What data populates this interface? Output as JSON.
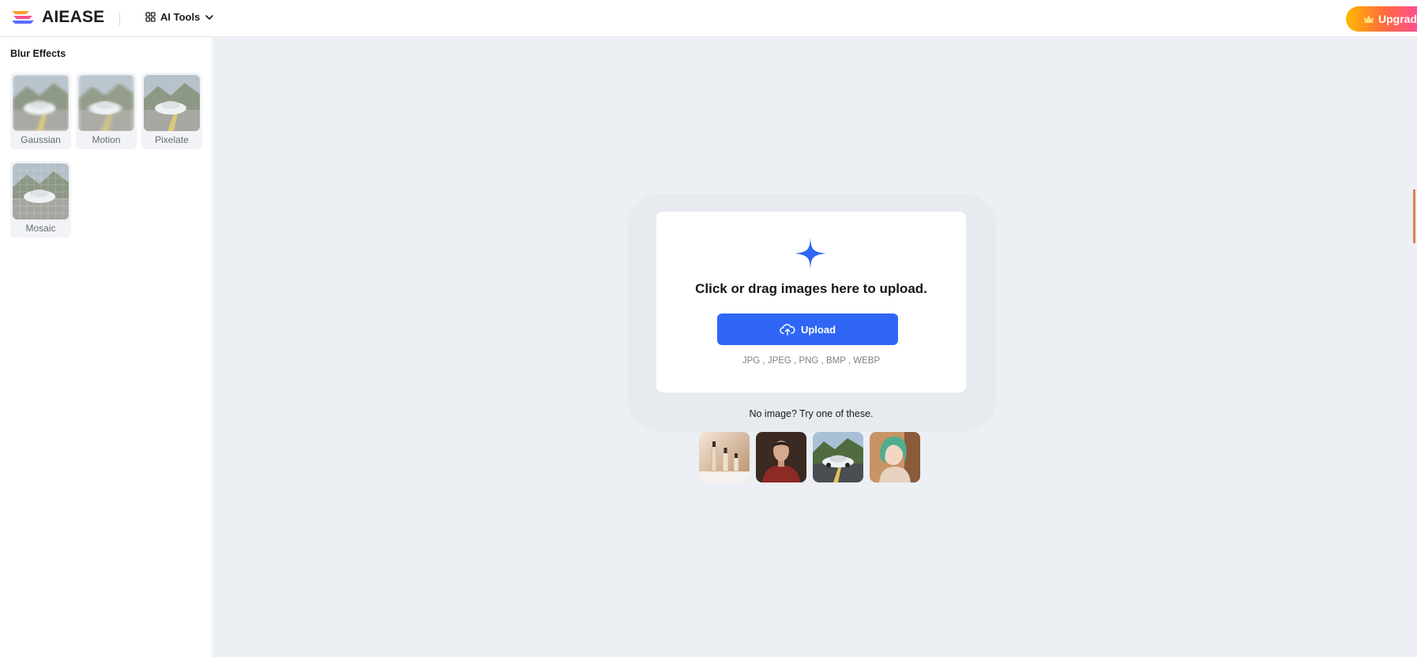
{
  "header": {
    "logo_text": "AIEASE",
    "ai_tools_label": "AI Tools",
    "upgrade_label": "Upgrade"
  },
  "sidebar": {
    "title": "Blur Effects",
    "effects": [
      {
        "label": "Gaussian"
      },
      {
        "label": "Motion"
      },
      {
        "label": "Pixelate"
      },
      {
        "label": "Mosaic"
      }
    ]
  },
  "upload": {
    "title": "Click or drag images here to upload.",
    "button_label": "Upload",
    "formats": "JPG , JPEG , PNG , BMP , WEBP",
    "try_text": "No image? Try one of these."
  },
  "samples": [
    {
      "name": "cosmetic-bottles"
    },
    {
      "name": "young-man-portrait"
    },
    {
      "name": "white-car-road"
    },
    {
      "name": "anime-girl-green-hair"
    }
  ],
  "colors": {
    "accent": "#2f66f6",
    "main_bg": "#eceff3",
    "upgrade_gradient_start": "#ffb800",
    "upgrade_gradient_end": "#ff3fb8"
  }
}
